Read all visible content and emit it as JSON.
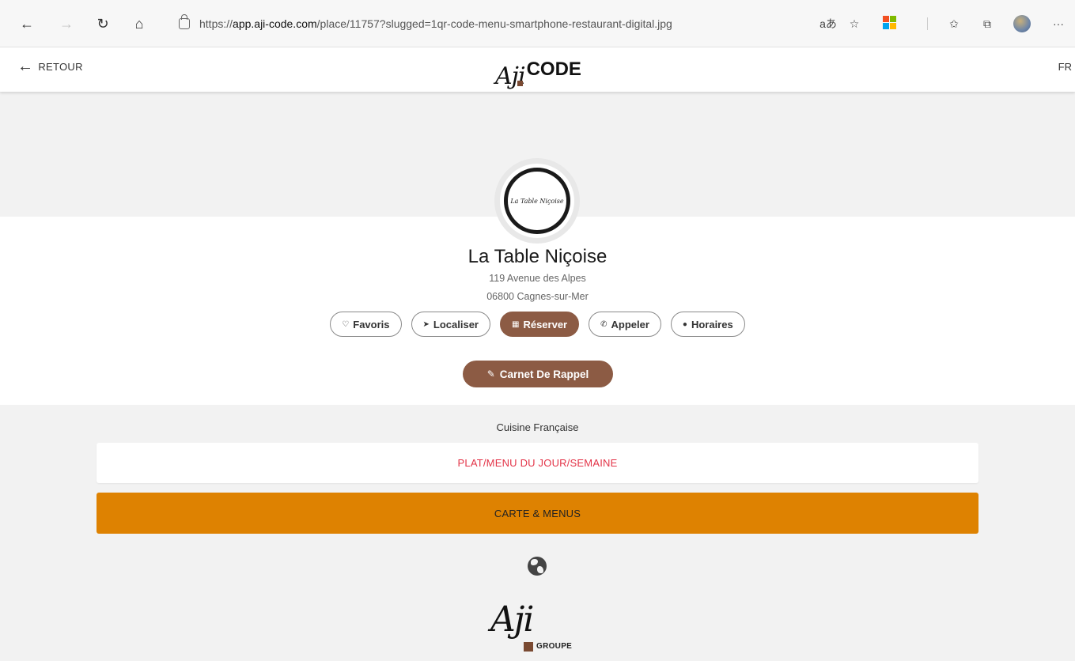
{
  "browser": {
    "url_prefix": "https://",
    "url_host": "app.aji-code.com",
    "url_path": "/place/11757?slugged=1qr-code-menu-smartphone-restaurant-digital.jpg",
    "read_aloud_label": "aあ",
    "more_label": "···"
  },
  "header": {
    "back_label": "RETOUR",
    "brand_script": "Aji",
    "brand_text": "CODE",
    "language": "FR"
  },
  "place": {
    "logo_text": "La Table Niçoise",
    "name": "La Table Niçoise",
    "address_line1": "119 Avenue des Alpes",
    "address_line2": "06800 Cagnes-sur-Mer"
  },
  "actions": {
    "favoris": "Favoris",
    "localiser": "Localiser",
    "reserver": "Réserver",
    "appeler": "Appeler",
    "horaires": "Horaires",
    "carnet": "Carnet De Rappel"
  },
  "menu": {
    "cuisine": "Cuisine Française",
    "daily_label": "PLAT/MENU DU JOUR/SEMAINE",
    "carte_label": "CARTE & MENUS"
  },
  "footer": {
    "brand_script": "Aji",
    "brand_sub": "GROUPE"
  },
  "colors": {
    "brown_accent": "#8c5b44",
    "orange_panel": "#de8201",
    "red_text": "#e33448"
  },
  "icons": [
    "back-icon",
    "forward-icon",
    "refresh-icon",
    "home-icon",
    "lock-icon",
    "heart-icon",
    "location-arrow-icon",
    "calendar-icon",
    "phone-icon",
    "clock-icon",
    "pencil-icon",
    "globe-icon"
  ]
}
